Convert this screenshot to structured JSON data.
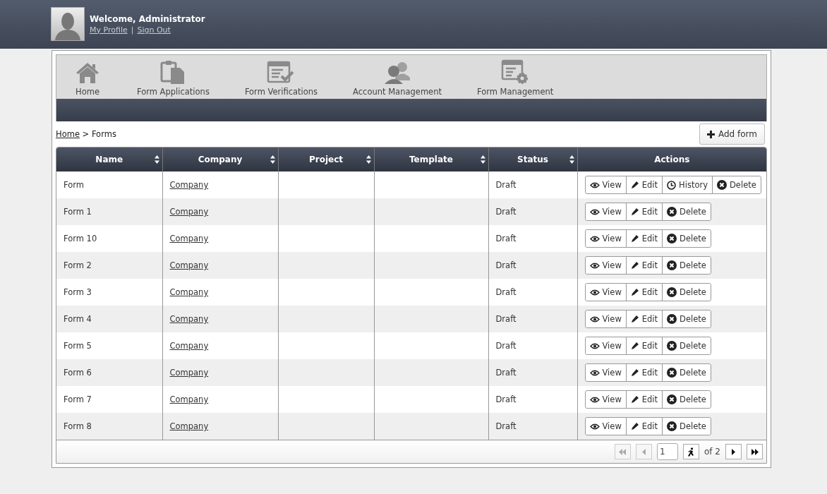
{
  "header": {
    "welcome": "Welcome, Administrator",
    "links": [
      "My Profile",
      "Sign Out"
    ],
    "separator": "|"
  },
  "nav": {
    "items": [
      {
        "label": "Home",
        "kind": "home"
      },
      {
        "label": "Form Applications",
        "kind": "applications"
      },
      {
        "label": "Form Verifications",
        "kind": "verifications"
      },
      {
        "label": "Account Management",
        "kind": "accounts"
      },
      {
        "label": "Form Management",
        "kind": "management"
      }
    ]
  },
  "breadcrumb": {
    "link": "Home",
    "separator": ">",
    "current": "Forms"
  },
  "add_button": "Add form",
  "table": {
    "columns": [
      "Name",
      "Company",
      "Project",
      "Template",
      "Status",
      "Actions"
    ],
    "rows": [
      {
        "name": "Form",
        "company": "Company",
        "status": "Draft",
        "actions": [
          {
            "kind": "view",
            "label": "View"
          },
          {
            "kind": "edit",
            "label": "Edit"
          },
          {
            "kind": "history",
            "label": "History"
          },
          {
            "kind": "delete",
            "label": "Delete"
          }
        ]
      },
      {
        "name": "Form 1",
        "company": "Company",
        "status": "Draft",
        "actions": [
          {
            "kind": "view",
            "label": "View"
          },
          {
            "kind": "edit",
            "label": "Edit"
          },
          {
            "kind": "delete",
            "label": "Delete"
          }
        ]
      },
      {
        "name": "Form 10",
        "company": "Company",
        "status": "Draft",
        "actions": [
          {
            "kind": "view",
            "label": "View"
          },
          {
            "kind": "edit",
            "label": "Edit"
          },
          {
            "kind": "delete",
            "label": "Delete"
          }
        ]
      },
      {
        "name": "Form 2",
        "company": "Company",
        "status": "Draft",
        "actions": [
          {
            "kind": "view",
            "label": "View"
          },
          {
            "kind": "edit",
            "label": "Edit"
          },
          {
            "kind": "delete",
            "label": "Delete"
          }
        ]
      },
      {
        "name": "Form 3",
        "company": "Company",
        "status": "Draft",
        "actions": [
          {
            "kind": "view",
            "label": "View"
          },
          {
            "kind": "edit",
            "label": "Edit"
          },
          {
            "kind": "delete",
            "label": "Delete"
          }
        ]
      },
      {
        "name": "Form 4",
        "company": "Company",
        "status": "Draft",
        "actions": [
          {
            "kind": "view",
            "label": "View"
          },
          {
            "kind": "edit",
            "label": "Edit"
          },
          {
            "kind": "delete",
            "label": "Delete"
          }
        ]
      },
      {
        "name": "Form 5",
        "company": "Company",
        "status": "Draft",
        "actions": [
          {
            "kind": "view",
            "label": "View"
          },
          {
            "kind": "edit",
            "label": "Edit"
          },
          {
            "kind": "delete",
            "label": "Delete"
          }
        ]
      },
      {
        "name": "Form 6",
        "company": "Company",
        "status": "Draft",
        "actions": [
          {
            "kind": "view",
            "label": "View"
          },
          {
            "kind": "edit",
            "label": "Edit"
          },
          {
            "kind": "delete",
            "label": "Delete"
          }
        ]
      },
      {
        "name": "Form 7",
        "company": "Company",
        "status": "Draft",
        "actions": [
          {
            "kind": "view",
            "label": "View"
          },
          {
            "kind": "edit",
            "label": "Edit"
          },
          {
            "kind": "delete",
            "label": "Delete"
          }
        ]
      },
      {
        "name": "Form 8",
        "company": "Company",
        "status": "Draft",
        "actions": [
          {
            "kind": "view",
            "label": "View"
          },
          {
            "kind": "edit",
            "label": "Edit"
          },
          {
            "kind": "delete",
            "label": "Delete"
          }
        ]
      }
    ]
  },
  "pager": {
    "buttons": [
      {
        "kind": "first",
        "disabled": true
      },
      {
        "kind": "prev",
        "disabled": true
      }
    ],
    "page": "1",
    "go_disabled": false,
    "of": "of 2",
    "after": [
      {
        "kind": "next",
        "disabled": false
      },
      {
        "kind": "last",
        "disabled": false
      }
    ]
  }
}
